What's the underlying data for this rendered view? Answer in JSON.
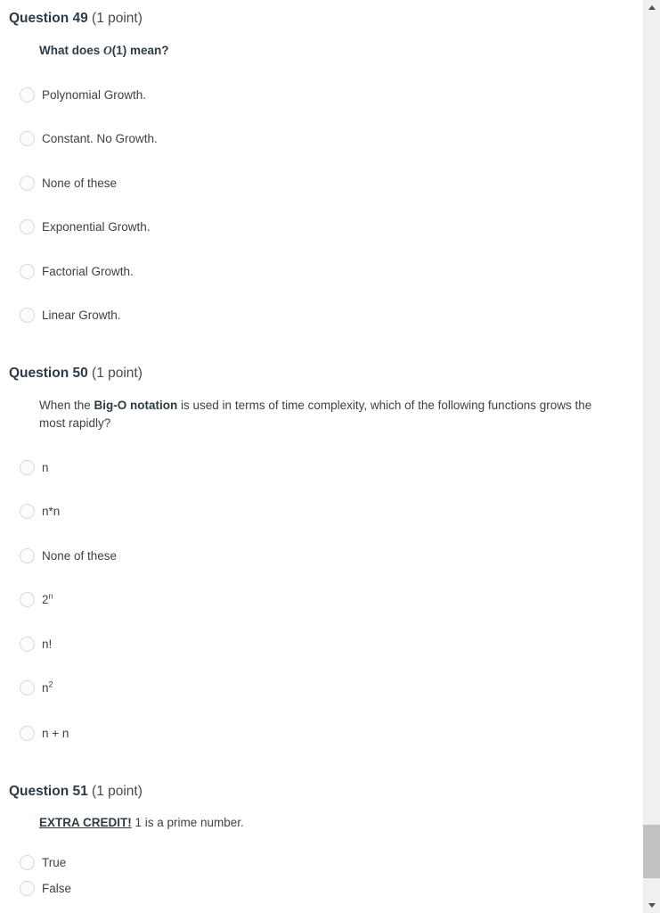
{
  "scrollbar": {
    "up_arrow": "scroll-up-arrow",
    "down_arrow": "scroll-down-arrow",
    "thumb": "scroll-thumb"
  },
  "questions": [
    {
      "label": "Question 49",
      "points": "(1 point)",
      "prompt_prefix": "What does ",
      "prompt_italic": "O",
      "prompt_suffix": "(1) mean?",
      "options": [
        "Polynomial Growth.",
        "Constant. No Growth.",
        "None of these",
        "Exponential Growth.",
        "Factorial Growth.",
        "Linear Growth."
      ]
    },
    {
      "label": "Question 50",
      "points": "(1 point)",
      "prompt_prefix": "When the ",
      "prompt_bold": "Big-O notation",
      "prompt_suffix": " is used in terms of time complexity, which of the following functions grows the most rapidly?",
      "options": [
        {
          "base": "n",
          "sup": ""
        },
        {
          "base": "n*n",
          "sup": ""
        },
        {
          "base": "None of these",
          "sup": ""
        },
        {
          "base": "2",
          "sup": "n"
        },
        {
          "base": "n!",
          "sup": ""
        },
        {
          "base": "n",
          "sup": "2"
        },
        {
          "base": "n + n",
          "sup": ""
        }
      ]
    },
    {
      "label": "Question 51",
      "points": "(1 point)",
      "prompt_bold_underline": "EXTRA CREDIT!",
      "prompt_suffix": " 1 is a prime number.",
      "options": [
        "True",
        "False"
      ]
    }
  ]
}
